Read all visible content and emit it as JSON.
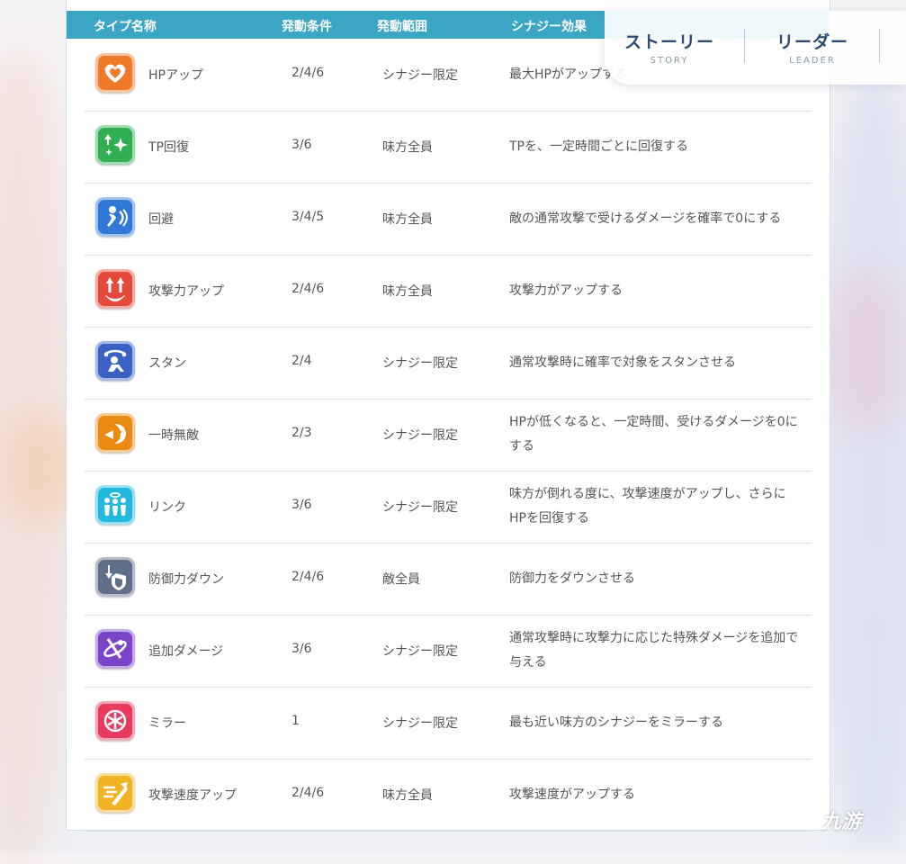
{
  "table": {
    "headers": {
      "type": "タイプ名称",
      "condition": "発動条件",
      "range": "発動範囲",
      "effect": "シナジー効果"
    },
    "rows": [
      {
        "icon": "heart-icon",
        "color": "#f07a2a",
        "name": "HPアップ",
        "condition": "2/4/6",
        "range": "シナジー限定",
        "effect": "最大HPがアップする"
      },
      {
        "icon": "sparkle-up-icon",
        "color": "#2fae54",
        "name": "TP回復",
        "condition": "3/6",
        "range": "味方全員",
        "effect": "TPを、一定時間ごとに回復する"
      },
      {
        "icon": "dodge-icon",
        "color": "#2f78d8",
        "name": "回避",
        "condition": "3/4/5",
        "range": "味方全員",
        "effect": "敵の通常攻撃で受けるダメージを確率で0にする"
      },
      {
        "icon": "attack-up-icon",
        "color": "#e4493a",
        "name": "攻撃力アップ",
        "condition": "2/4/6",
        "range": "味方全員",
        "effect": "攻撃力がアップする"
      },
      {
        "icon": "stun-icon",
        "color": "#3a62c4",
        "name": "スタン",
        "condition": "2/4",
        "range": "シナジー限定",
        "effect": "通常攻撃時に確率で対象をスタンさせる"
      },
      {
        "icon": "invincible-icon",
        "color": "#e98a12",
        "name": "一時無敵",
        "condition": "2/3",
        "range": "シナジー限定",
        "effect": "HPが低くなると、一定時間、受けるダメージを0にする"
      },
      {
        "icon": "link-icon",
        "color": "#22b9e0",
        "name": "リンク",
        "condition": "3/6",
        "range": "シナジー限定",
        "effect": "味方が倒れる度に、攻撃速度がアップし、さらにHPを回復する"
      },
      {
        "icon": "defense-down-icon",
        "color": "#5f6f88",
        "name": "防御力ダウン",
        "condition": "2/4/6",
        "range": "敵全員",
        "effect": "防御力をダウンさせる"
      },
      {
        "icon": "extra-damage-icon",
        "color": "#7a45c9",
        "name": "追加ダメージ",
        "condition": "3/6",
        "range": "シナジー限定",
        "effect": "通常攻撃時に攻撃力に応じた特殊ダメージを追加で与える"
      },
      {
        "icon": "mirror-icon",
        "color": "#e73a5c",
        "name": "ミラー",
        "condition": "1",
        "range": "シナジー限定",
        "effect": "最も近い味方のシナジーをミラーする"
      },
      {
        "icon": "attack-speed-icon",
        "color": "#efb324",
        "name": "攻撃速度アップ",
        "condition": "2/4/6",
        "range": "味方全員",
        "effect": "攻撃速度がアップする"
      }
    ]
  },
  "nav": {
    "story": {
      "label": "ストーリー",
      "sub": "STORY"
    },
    "leader": {
      "label": "リーダー",
      "sub": "LEADER"
    }
  },
  "watermark": "九游"
}
